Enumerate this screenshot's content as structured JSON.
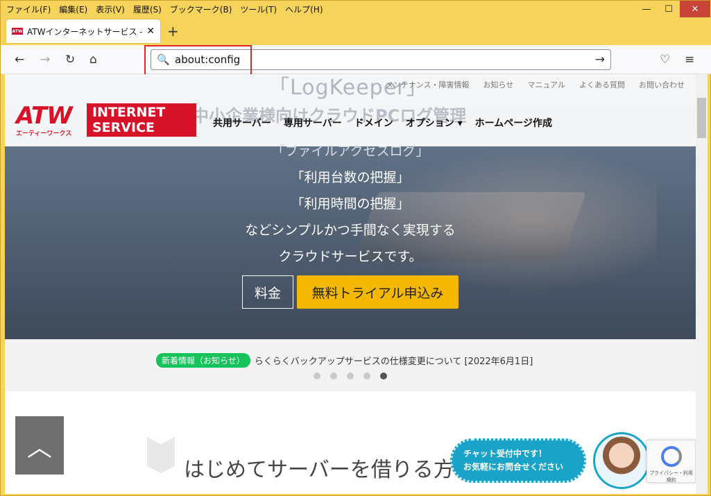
{
  "menubar": {
    "items": [
      "ファイル(F)",
      "編集(E)",
      "表示(V)",
      "履歴(S)",
      "ブックマーク(B)",
      "ツール(T)",
      "ヘルプ(H)"
    ]
  },
  "window_controls": {
    "minimize": "—",
    "maximize": "☐",
    "close": "✕"
  },
  "tab": {
    "favicon": "ATW",
    "title": "ATWインターネットサービス – 会社",
    "close": "✕"
  },
  "newtab": "+",
  "nav": {
    "back": "←",
    "forward": "→",
    "reload": "↻",
    "home": "⌂",
    "pocket": "♡",
    "menu": "≡"
  },
  "urlbar": {
    "value": "about:config",
    "search_icon": "🔍",
    "go": "→"
  },
  "page": {
    "utility_links": [
      "メンテナンス・障害情報",
      "お知らせ",
      "マニュアル",
      "よくある質問",
      "お問い合わせ"
    ],
    "hero_title_top": "「LogKeeper」",
    "hero_tagline": "中小企業様向けクラウドPCログ管理",
    "logo": {
      "atw": "ATW",
      "atw_sub": "エーティーワークス",
      "box_line1": "INTERNET",
      "box_line2": "SERVICE"
    },
    "mainnav": [
      "共用サーバー",
      "専用サーバー",
      "ドメイン",
      "オプション ▾",
      "ホームページ作成"
    ],
    "hero_lines": [
      "「ファイルアクセスログ」",
      "「利用台数の把握」",
      "「利用時間の把握」",
      "などシンプルかつ手間なく実現する",
      "クラウドサービスです。"
    ],
    "btn_price": "料金",
    "btn_trial": "無料トライアル申込み",
    "news": {
      "badge": "新着情報（お知らせ）",
      "text": "らくらくバックアップサービスの仕様変更について [2022年6月1日]"
    },
    "dots": {
      "count": 5,
      "active_index": 4
    },
    "lower_heading": "はじめてサーバーを借りる方",
    "scrolltop_icon": "︿",
    "chat": {
      "line1": "チャット受付中です！",
      "line2": "お気軽にお問合せください"
    },
    "recaptcha": {
      "text": "プライバシー・利用規約"
    }
  },
  "colors": {
    "brand_red": "#d7132a",
    "trial_yellow": "#f5b800",
    "news_green": "#16c25a",
    "chat_blue": "#1aa3c9",
    "highlight_red": "#e3262a"
  }
}
